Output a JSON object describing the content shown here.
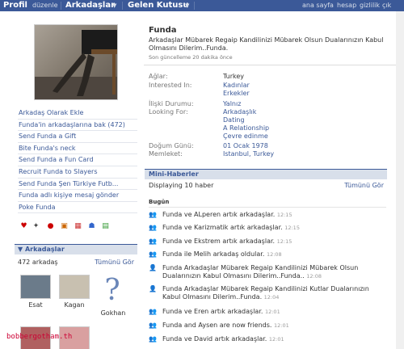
{
  "topbar": {
    "profile": "Profil",
    "edit": "düzenle",
    "friends": "Arkadaşlar",
    "inbox": "Gelen Kutusu",
    "home": "ana sayfa",
    "account": "hesap",
    "privacy": "gizlilik",
    "logout": "çık",
    "caret": "▼"
  },
  "sidebar": {
    "links": [
      "Arkadaş Olarak Ekle",
      "Funda'in arkadaşlarına bak (472)",
      "Send Funda a Gift",
      "Bite Funda's neck",
      "Send Funda a Fun Card",
      "Recruit Funda to Slayers",
      "Send Funda Şen Türkiye Futb...",
      "Funda adlı kişiye mesaj gönder",
      "Poke Funda"
    ]
  },
  "friends_box": {
    "title": "Arkadaşlar",
    "count": "472 arkadaş",
    "see_all": "Tümünü Gör",
    "friends": [
      "Esat",
      "Kagan",
      "Gokhan"
    ]
  },
  "profile": {
    "name": "Funda",
    "status": "Arkadaşlar Mübarek Regaip Kandilinizi Mübarek Olsun Dualarınızın Kabul Olmasını Dilerim..Funda.",
    "updated": "Son güncelleme 20 dakika önce"
  },
  "info": {
    "network_label": "Ağlar:",
    "network_value": "Turkey",
    "interested_label": "Interested In:",
    "interested_values": [
      "Kadınlar",
      "Erkekler"
    ],
    "relationship_label": "İlişki Durumu:",
    "relationship_value": "Yalnız",
    "looking_label": "Looking For:",
    "looking_values": [
      "Arkadaşlık",
      "Dating",
      "A Relationship",
      "Çevre edinme"
    ],
    "birthday_label": "Doğum Günü:",
    "birthday_value": "01 Ocak 1978",
    "hometown_label": "Memleket:",
    "hometown_value": "Istanbul, Turkey"
  },
  "minifeed": {
    "title": "Mini-Haberler",
    "displaying": "Displaying 10 haber",
    "see_all": "Tümünü Gör",
    "today": "Bugün",
    "items": [
      {
        "text": "Funda ve ALperen        artık arkadaşlar.",
        "time": "12:15"
      },
      {
        "text": "Funda ve Karizmatik        artık arkadaşlar.",
        "time": "12:15"
      },
      {
        "text": "Funda ve Ekstrem        artık arkadaşlar.",
        "time": "12:15"
      },
      {
        "text": "Funda ile Melih        arkadaş oldular.",
        "time": "12:08"
      },
      {
        "text": "Funda Arkadaşlar Mübarek Regaip Kandilinizi Mübarek Olsun Dualarınızın Kabul Olmasını Dilerim..Funda..",
        "time": "12:08"
      },
      {
        "text": "Funda Arkadaşlar Mübarek Regaip Kandilinizi Kutlar Dualarınızın Kabul Olmasını Dilerim..Funda.",
        "time": "12:04"
      },
      {
        "text": "Funda ve Eren        artık arkadaşlar.",
        "time": "12:01"
      },
      {
        "text": "Funda and Aysen        are now friends.",
        "time": "12:01"
      },
      {
        "text": "Funda ve David        artık arkadaşlar.",
        "time": "12:01"
      }
    ]
  },
  "watermark": "bobbergotham.th"
}
